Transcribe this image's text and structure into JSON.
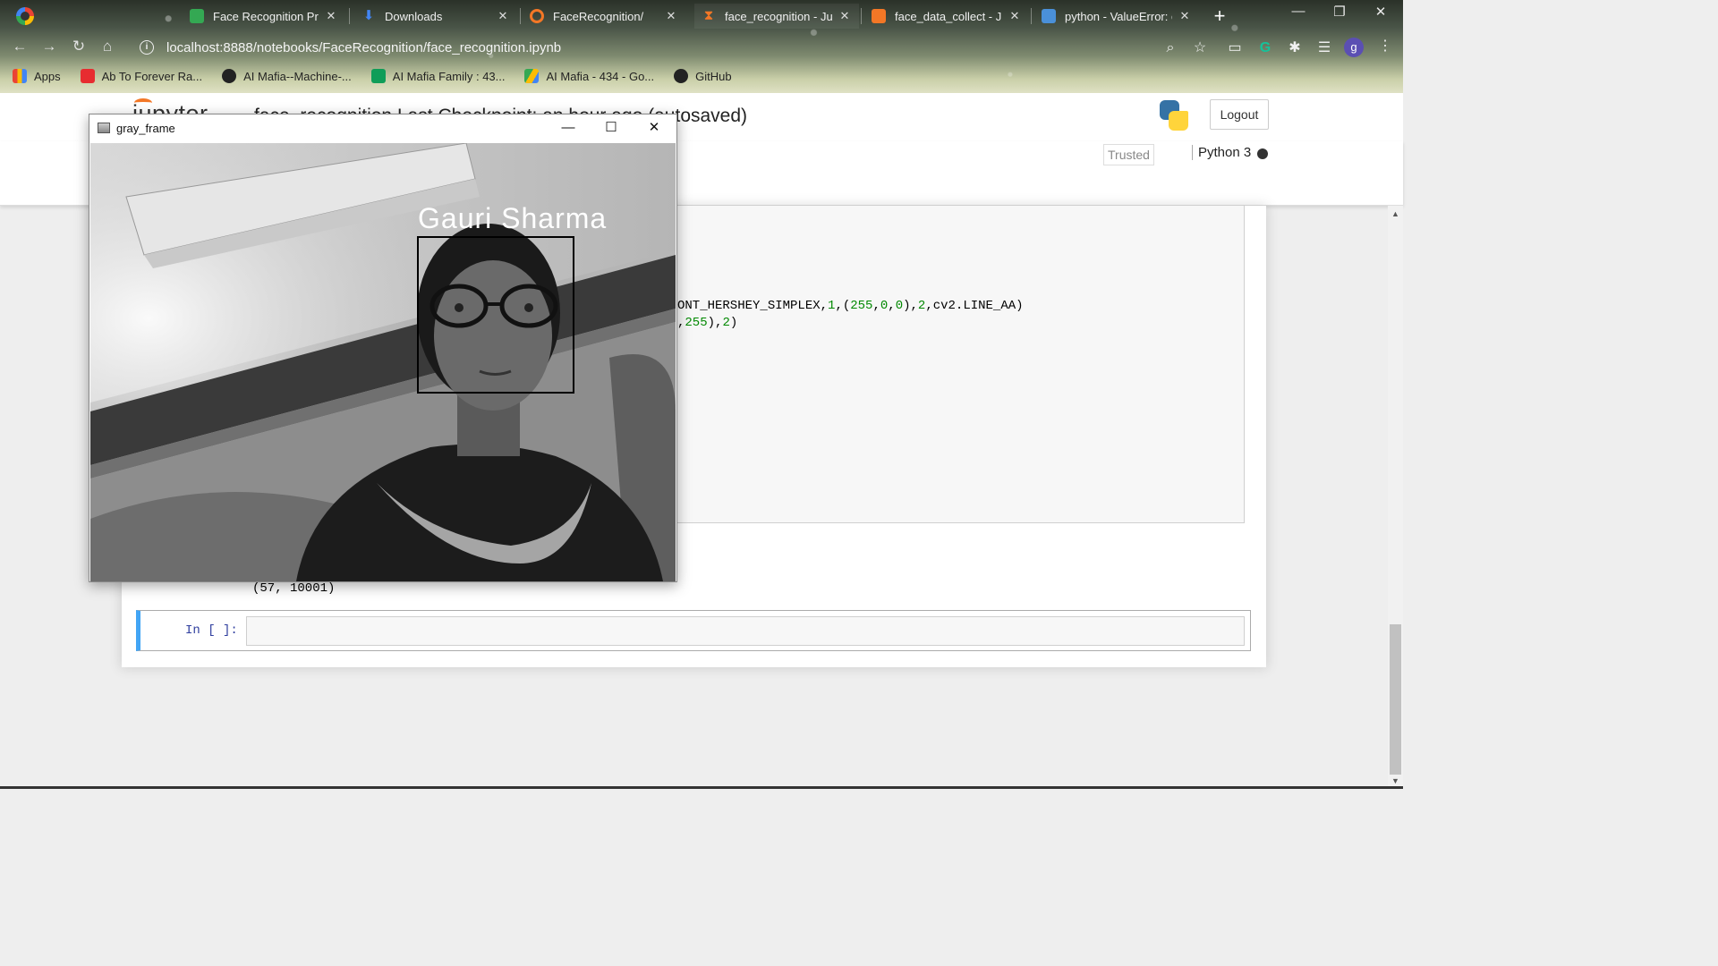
{
  "browser": {
    "tabs": [
      {
        "title": "Face Recognition Proje",
        "favicon": "drive-icon",
        "color": "#34a853"
      },
      {
        "title": "Downloads",
        "favicon": "download-icon",
        "color": "#4285f4"
      },
      {
        "title": "FaceRecognition/",
        "favicon": "jupyter-icon",
        "color": "#f37726"
      },
      {
        "title": "face_recognition - Jupy",
        "favicon": "hourglass-icon",
        "color": "#f37726"
      },
      {
        "title": "face_data_collect - Jup",
        "favicon": "notebook-icon",
        "color": "#f37726"
      },
      {
        "title": "python - ValueError: o",
        "favicon": "stackoverflow-icon",
        "color": "#4a90d9"
      }
    ],
    "url": "localhost:8888/notebooks/FaceRecognition/face_recognition.ipynb",
    "avatar_letter": "g",
    "bookmarks": [
      {
        "label": "Apps",
        "icon": "apps-icon",
        "color": "#ea4335"
      },
      {
        "label": "Ab To Forever Ra...",
        "icon": "gaana-icon",
        "color": "#e72c30"
      },
      {
        "label": "AI Mafia--Machine-...",
        "icon": "github-icon",
        "color": "#222222"
      },
      {
        "label": "AI Mafia Family : 43...",
        "icon": "sheets-icon",
        "color": "#0f9d58"
      },
      {
        "label": "AI Mafia - 434 - Go...",
        "icon": "drive-icon",
        "color": "#34a853"
      },
      {
        "label": "GitHub",
        "icon": "github-icon",
        "color": "#222222"
      }
    ]
  },
  "jupyter": {
    "logo_text": "jupyter",
    "notebook_title": "face_recognition Last Checkpoint: an hour ago  (autosaved)",
    "logout_label": "Logout",
    "trusted_label": "Trusted",
    "kernel_label": "Python 3"
  },
  "notebook": {
    "code_line_1_prefix": "ONT_HERSHEY_SIMPLEX,",
    "code_line_1_args": [
      "1",
      "255",
      "0",
      "0",
      "2"
    ],
    "code_line_1_suffix": "cv2.LINE_AA)",
    "code_line_2_value": "255",
    "code_line_2_tail": "2",
    "output_text": "(57, 10001)",
    "empty_prompt": "In [ ]:"
  },
  "cv_window": {
    "title": "gray_frame",
    "face_label": "Gauri Sharma"
  }
}
